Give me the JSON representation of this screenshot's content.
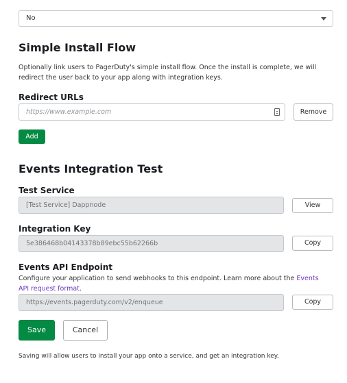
{
  "top_select": {
    "value": "No"
  },
  "simple_install": {
    "heading": "Simple Install Flow",
    "description": "Optionally link users to PagerDuty's simple install flow. Once the install is complete, we will redirect the user back to your app along with integration keys.",
    "redirect_label": "Redirect URLs",
    "redirect_placeholder": "https://www.example.com",
    "remove_label": "Remove",
    "add_label": "Add"
  },
  "events_test": {
    "heading": "Events Integration Test",
    "test_service_label": "Test Service",
    "test_service_value": "[Test Service] Dappnode",
    "view_label": "View",
    "integration_key_label": "Integration Key",
    "integration_key_value": "5e386468b04143378b89ebc55b62266b",
    "copy_label": "Copy",
    "endpoint_label": "Events API Endpoint",
    "endpoint_desc_prefix": "Configure your application to send webhooks to this endpoint. Learn more about the ",
    "endpoint_desc_link": "Events API request format",
    "endpoint_desc_suffix": ".",
    "endpoint_value": "https://events.pagerduty.com/v2/enqueue",
    "copy_label_2": "Copy"
  },
  "actions": {
    "save_label": "Save",
    "cancel_label": "Cancel",
    "footer_note": "Saving will allow users to install your app onto a service, and get an integration key."
  },
  "colors": {
    "primary_green": "#048a42",
    "link_purple": "#6f36c5",
    "readonly_bg": "#e4e5e6"
  }
}
